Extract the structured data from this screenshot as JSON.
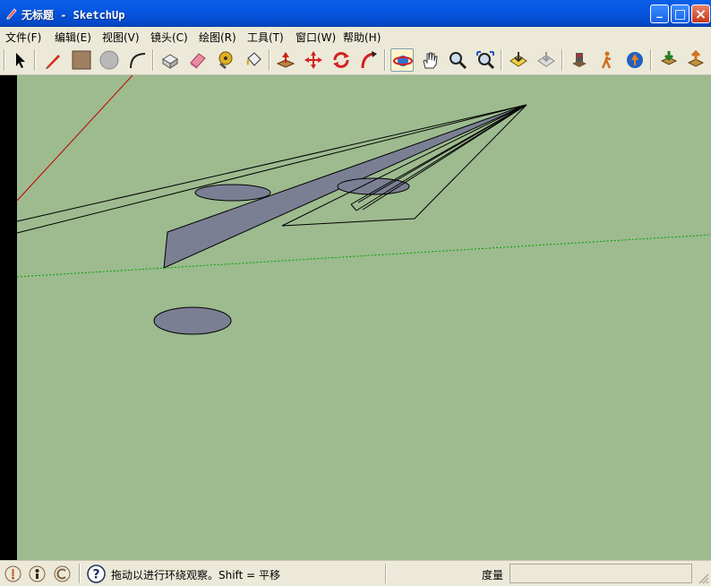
{
  "window": {
    "title": "无标题 - SketchUp",
    "minimize_label": "_",
    "maximize_label": "□",
    "close_label": "×"
  },
  "menu": {
    "items": [
      {
        "label": "文件(F)"
      },
      {
        "label": "编辑(E)"
      },
      {
        "label": "视图(V)"
      },
      {
        "label": "镜头(C)"
      },
      {
        "label": "绘图(R)"
      },
      {
        "label": "工具(T)"
      },
      {
        "label": "窗口(W)"
      },
      {
        "label": "帮助(H)"
      }
    ]
  },
  "toolbar": {
    "tools": [
      {
        "icon": "select-arrow-icon"
      },
      {
        "icon": "pencil-line-icon"
      },
      {
        "icon": "rectangle-icon"
      },
      {
        "icon": "circle-icon"
      },
      {
        "icon": "arc-icon"
      },
      {
        "icon": "make-component-icon"
      },
      {
        "icon": "eraser-icon"
      },
      {
        "icon": "tape-measure-icon"
      },
      {
        "icon": "paint-bucket-icon"
      },
      {
        "icon": "push-pull-icon"
      },
      {
        "icon": "move-icon"
      },
      {
        "icon": "rotate-icon"
      },
      {
        "icon": "follow-me-icon"
      },
      {
        "icon": "orbit-icon",
        "active": true
      },
      {
        "icon": "pan-icon"
      },
      {
        "icon": "zoom-icon"
      },
      {
        "icon": "zoom-extents-icon"
      },
      {
        "icon": "previous-view-icon"
      },
      {
        "icon": "next-view-icon"
      },
      {
        "icon": "position-camera-icon"
      },
      {
        "icon": "walk-icon"
      },
      {
        "icon": "look-around-icon"
      },
      {
        "icon": "get-models-icon"
      },
      {
        "icon": "share-model-icon"
      }
    ]
  },
  "status": {
    "text": "拖动以进行环绕观察。Shift = 平移",
    "measure_label": "度量",
    "measure_value": ""
  },
  "colors": {
    "viewport_background": "#9dbb8f",
    "face_color": "#7b7f94",
    "red_axis": "#c00000",
    "green_axis": "#00a000",
    "titlebar": "#0656e0"
  }
}
